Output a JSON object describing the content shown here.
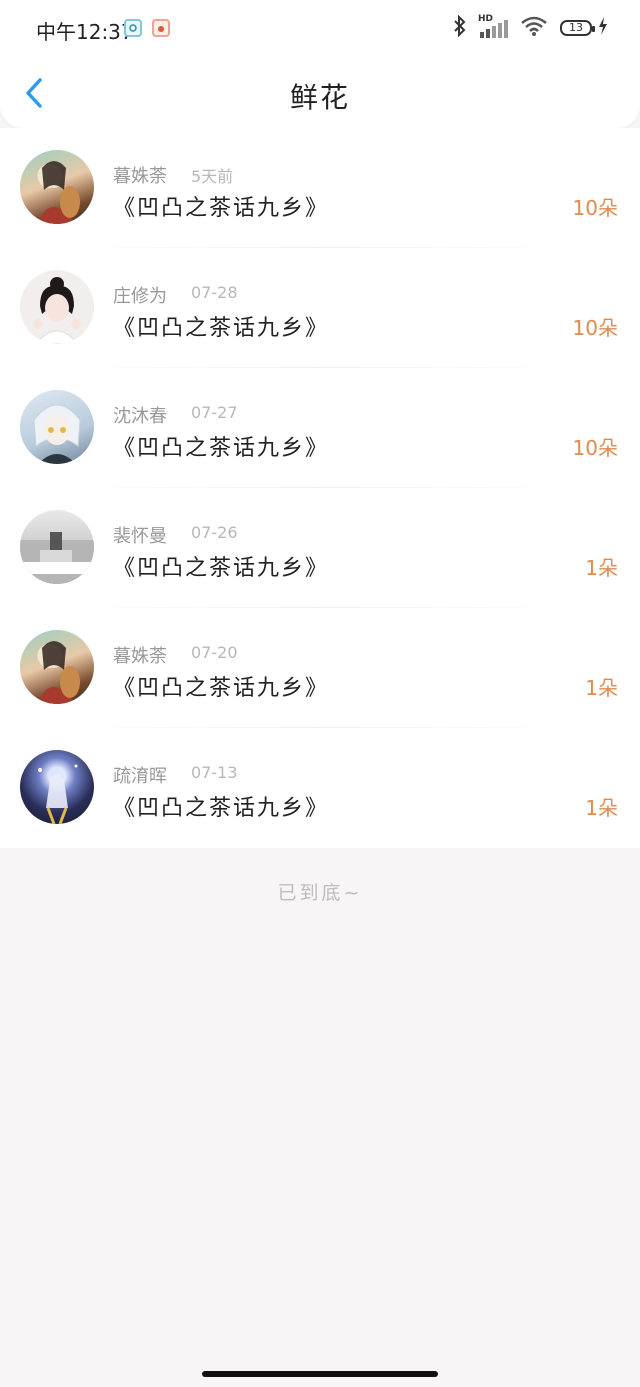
{
  "status_bar": {
    "time": "中午12:37",
    "battery": "13"
  },
  "header": {
    "title": "鲜花"
  },
  "list": {
    "items": [
      {
        "name": "暮姝荼",
        "date": "5天前",
        "title": "《凹凸之茶话九乡》",
        "count": "10朵"
      },
      {
        "name": "庄修为",
        "date": "07-28",
        "title": "《凹凸之茶话九乡》",
        "count": "10朵"
      },
      {
        "name": "沈沐春",
        "date": "07-27",
        "title": "《凹凸之茶话九乡》",
        "count": "10朵"
      },
      {
        "name": "裴怀曼",
        "date": "07-26",
        "title": "《凹凸之茶话九乡》",
        "count": "1朵"
      },
      {
        "name": "暮姝荼",
        "date": "07-20",
        "title": "《凹凸之茶话九乡》",
        "count": "1朵"
      },
      {
        "name": "疏淯晖",
        "date": "07-13",
        "title": "《凹凸之茶话九乡》",
        "count": "1朵"
      }
    ]
  },
  "footer": {
    "end_text": "已到底~"
  },
  "colors": {
    "accent_blue": "#2d9cf0",
    "count_orange": "#e38a4d"
  }
}
